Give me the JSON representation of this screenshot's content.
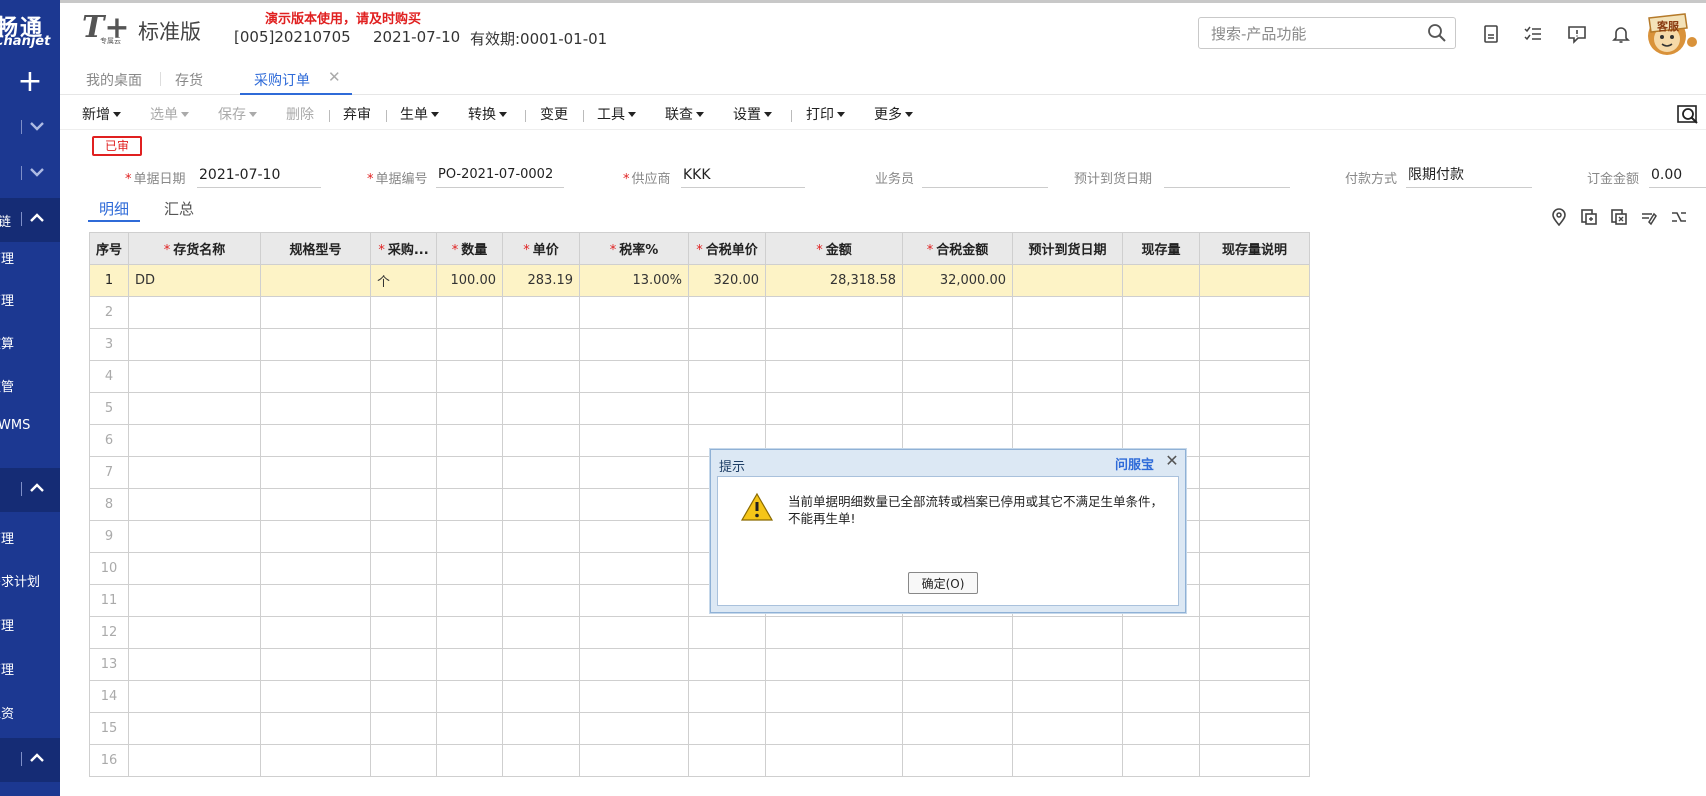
{
  "sidebar": {
    "logo_line1": "畅通",
    "logo_line2": "Chanjet",
    "add_symbol": "+",
    "items": [
      "管理",
      "管理",
      "核算",
      "监管",
      "WMS",
      "管理",
      "需求计划",
      "管理",
      "管理",
      "工资"
    ],
    "section_label": "链"
  },
  "topbar": {
    "brand_logo": "T+",
    "brand_sub": "专属云",
    "brand_name": "标准版",
    "demo_warning": "演示版本使用，请及时购买",
    "account": "[005]20210705",
    "login_date": "2021-07-10",
    "validity": "有效期:0001-01-01",
    "search_placeholder": "搜索-产品功能",
    "kefu_label": "客服"
  },
  "tabs": [
    "我的桌面",
    "存货",
    "采购订单"
  ],
  "toolbar": [
    {
      "label": "新增",
      "caret": true,
      "disabled": false
    },
    {
      "label": "选单",
      "caret": true,
      "disabled": true
    },
    {
      "label": "保存",
      "caret": true,
      "disabled": true
    },
    {
      "label": "删除",
      "caret": false,
      "disabled": true
    },
    {
      "label": "弃审",
      "caret": false,
      "disabled": false
    },
    {
      "label": "生单",
      "caret": true,
      "disabled": false
    },
    {
      "label": "转换",
      "caret": true,
      "disabled": false
    },
    {
      "label": "变更",
      "caret": false,
      "disabled": false
    },
    {
      "label": "工具",
      "caret": true,
      "disabled": false
    },
    {
      "label": "联查",
      "caret": true,
      "disabled": false
    },
    {
      "label": "设置",
      "caret": true,
      "disabled": false
    },
    {
      "label": "打印",
      "caret": true,
      "disabled": false
    },
    {
      "label": "更多",
      "caret": true,
      "disabled": false
    }
  ],
  "form": {
    "status": "已审",
    "fields": [
      {
        "label": "单据日期",
        "required": true,
        "value": "2021-07-10"
      },
      {
        "label": "单据编号",
        "required": true,
        "value": "PO-2021-07-0002"
      },
      {
        "label": "供应商",
        "required": true,
        "value": "KKK"
      },
      {
        "label": "业务员",
        "required": false,
        "value": ""
      },
      {
        "label": "预计到货日期",
        "required": false,
        "value": ""
      },
      {
        "label": "付款方式",
        "required": false,
        "value": "限期付款"
      },
      {
        "label": "订金金额",
        "required": false,
        "value": "0.00"
      }
    ]
  },
  "subtabs": [
    "明细",
    "汇总"
  ],
  "grid": {
    "columns": [
      {
        "label": "序号",
        "required": false
      },
      {
        "label": "存货名称",
        "required": true
      },
      {
        "label": "规格型号",
        "required": false
      },
      {
        "label": "采购...",
        "required": true
      },
      {
        "label": "数量",
        "required": true
      },
      {
        "label": "单价",
        "required": true
      },
      {
        "label": "税率%",
        "required": true
      },
      {
        "label": "合税单价",
        "required": true
      },
      {
        "label": "金额",
        "required": true
      },
      {
        "label": "合税金额",
        "required": true
      },
      {
        "label": "预计到货日期",
        "required": false
      },
      {
        "label": "现存量",
        "required": false
      },
      {
        "label": "现存量说明",
        "required": false
      }
    ],
    "rows": [
      [
        "1",
        "DD",
        "",
        "个",
        "100.00",
        "283.19",
        "13.00%",
        "320.00",
        "28,318.58",
        "32,000.00",
        "",
        "",
        ""
      ],
      [
        "2"
      ],
      [
        "3"
      ],
      [
        "4"
      ],
      [
        "5"
      ],
      [
        "6"
      ],
      [
        "7"
      ],
      [
        "8"
      ],
      [
        "9"
      ],
      [
        "10"
      ],
      [
        "11"
      ],
      [
        "12"
      ],
      [
        "13"
      ],
      [
        "14"
      ],
      [
        "15"
      ],
      [
        "16"
      ]
    ]
  },
  "dialog": {
    "title": "提示",
    "help_link": "问服宝",
    "message": "当前单据明细数量已全部流转或档案已停用或其它不满足生单条件，不能再生单!",
    "ok_label": "确定(O)"
  }
}
